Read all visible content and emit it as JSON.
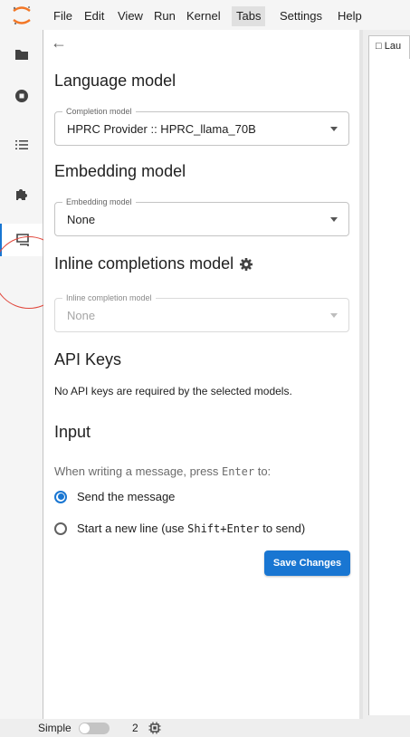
{
  "menubar": {
    "items": [
      "File",
      "Edit",
      "View",
      "Run",
      "Kernel",
      "Tabs",
      "Settings",
      "Help"
    ],
    "active_index": 5,
    "logo_icon": "jupyter-logo-icon"
  },
  "activity_bar": {
    "icons": [
      "folder-icon",
      "running-kernels-icon",
      "table-of-contents-icon",
      "extensions-icon",
      "chat-icon"
    ],
    "selected_index": 4,
    "annotation_color": "#e0453a"
  },
  "settings": {
    "back_icon": "arrow-left-icon",
    "language_model": {
      "title": "Language model",
      "field_label": "Completion model",
      "value": "HPRC Provider :: HPRC_llama_70B"
    },
    "embedding_model": {
      "title": "Embedding model",
      "field_label": "Embedding model",
      "value": "None"
    },
    "inline_completions": {
      "title": "Inline completions model",
      "title_icon": "gear-icon",
      "field_label": "Inline completion model",
      "value": "None"
    },
    "api_keys": {
      "title": "API Keys",
      "message": "No API keys are required by the selected models."
    },
    "input": {
      "title": "Input",
      "prompt_prefix": "When writing a message, press ",
      "prompt_key": "Enter",
      "prompt_suffix": " to:",
      "option_send": "Send the message",
      "option_newline_prefix": "Start a new line (use ",
      "option_newline_key": "Shift+Enter",
      "option_newline_suffix": " to send)",
      "selected": "send"
    },
    "save_button": "Save Changes"
  },
  "main": {
    "tab_label": "Lau",
    "tab_icon": "launcher-icon"
  },
  "statusbar": {
    "simple_label": "Simple",
    "simple_enabled": false,
    "kernel_count": "2",
    "kernel_icon": "kernel-icon"
  },
  "colors": {
    "accent": "#1976d2",
    "jupyter_orange": "#f37726"
  }
}
